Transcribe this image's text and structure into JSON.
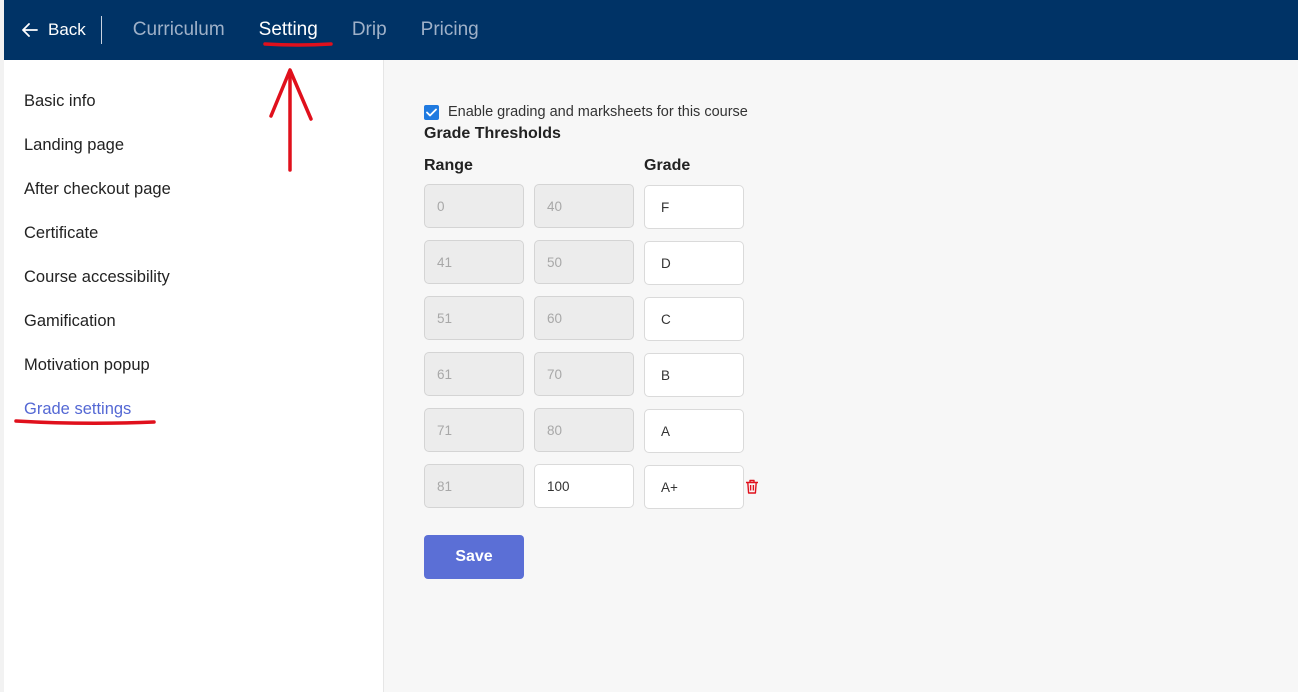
{
  "nav": {
    "back_label": "Back",
    "tabs": [
      {
        "label": "Curriculum",
        "active": false
      },
      {
        "label": "Setting",
        "active": true
      },
      {
        "label": "Drip",
        "active": false
      },
      {
        "label": "Pricing",
        "active": false
      }
    ]
  },
  "sidebar": {
    "items": [
      {
        "label": "Basic info"
      },
      {
        "label": "Landing page"
      },
      {
        "label": "After checkout page"
      },
      {
        "label": "Certificate"
      },
      {
        "label": "Course accessibility"
      },
      {
        "label": "Gamification"
      },
      {
        "label": "Motivation popup"
      },
      {
        "label": "Grade settings",
        "active": true
      }
    ]
  },
  "main": {
    "enable_label": "Enable grading and marksheets for this course",
    "enable_checked": true,
    "section_title": "Grade Thresholds",
    "range_header": "Range",
    "grade_header": "Grade",
    "rows": [
      {
        "min": "0",
        "max": "40",
        "grade": "F"
      },
      {
        "min": "41",
        "max": "50",
        "grade": "D"
      },
      {
        "min": "51",
        "max": "60",
        "grade": "C"
      },
      {
        "min": "61",
        "max": "70",
        "grade": "B"
      },
      {
        "min": "71",
        "max": "80",
        "grade": "A"
      },
      {
        "min": "81",
        "max": "100",
        "grade": "A+"
      }
    ],
    "save_label": "Save"
  },
  "colors": {
    "nav_bg": "#003366",
    "accent": "#5b6fd6",
    "annotation": "#e0101c",
    "delete": "#e0101c"
  }
}
